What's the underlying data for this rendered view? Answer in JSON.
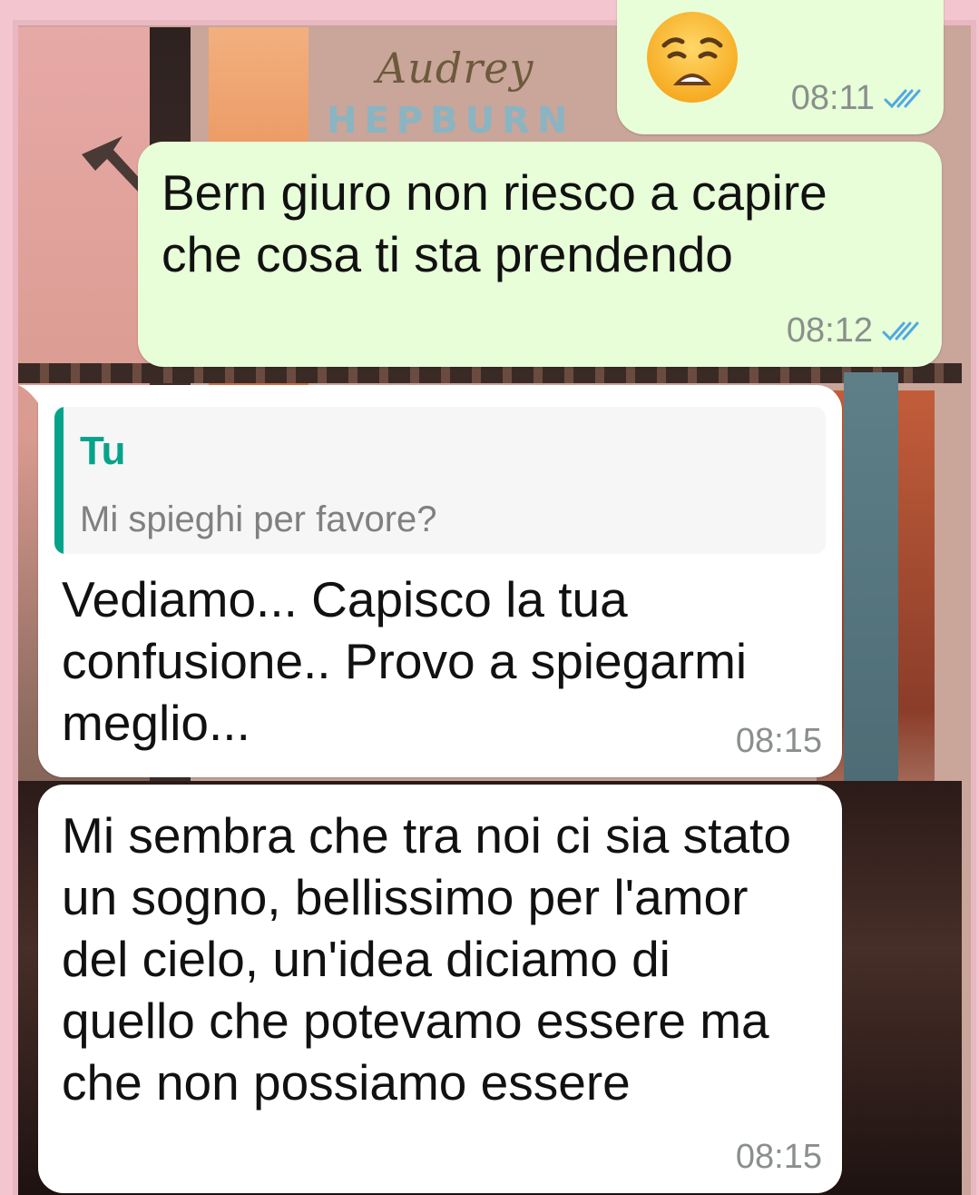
{
  "wallpaper": {
    "script_text": "Audrey",
    "caps_text": "HEPBURN"
  },
  "colors": {
    "outgoing_bubble": "#e7fed8",
    "incoming_bubble": "#ffffff",
    "read_ticks": "#4fa9e2",
    "quote_accent": "#06a38b"
  },
  "messages": [
    {
      "direction": "outgoing",
      "content": "weary-face-emoji",
      "time": "08:11",
      "status": "read"
    },
    {
      "direction": "outgoing",
      "text": "Bern giuro non riesco a capire che cosa ti sta prendendo",
      "time": "08:12",
      "status": "read"
    },
    {
      "direction": "incoming",
      "quote": {
        "author": "Tu",
        "text": "Mi spieghi per favore?"
      },
      "text": "Vediamo... Capisco la tua confusione.. Provo a spiegarmi meglio...",
      "time": "08:15"
    },
    {
      "direction": "incoming",
      "text": "Mi sembra che tra noi ci sia stato un sogno, bellissimo per l'amor del cielo, un'idea diciamo di quello che potevamo essere ma che non possiamo essere",
      "time": "08:15"
    }
  ]
}
